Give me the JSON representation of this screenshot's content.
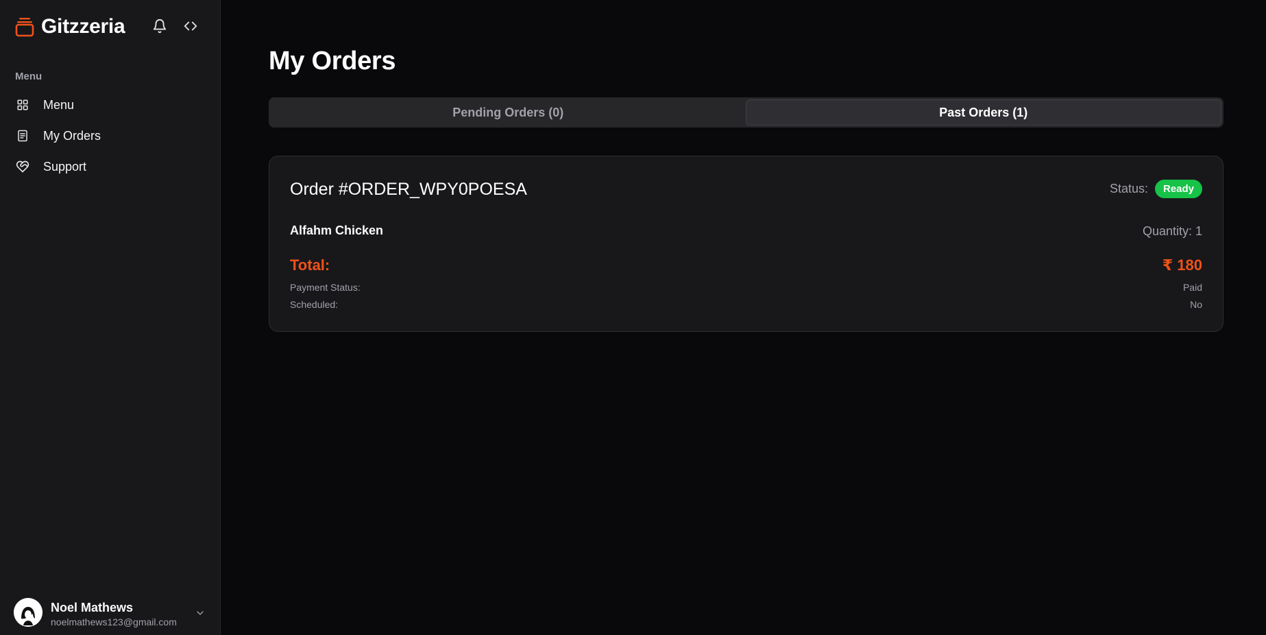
{
  "brand": {
    "name": "Gitzzeria",
    "accent": "#f0521a"
  },
  "sidebar": {
    "heading": "Menu",
    "items": [
      {
        "label": "Menu",
        "icon": "grid-icon"
      },
      {
        "label": "My Orders",
        "icon": "receipt-icon"
      },
      {
        "label": "Support",
        "icon": "heart-handshake-icon"
      }
    ],
    "user": {
      "name": "Noel Mathews",
      "email": "noelmathews123@gmail.com"
    }
  },
  "main": {
    "title": "My Orders",
    "tabs": [
      {
        "label": "Pending Orders (0)",
        "active": false
      },
      {
        "label": "Past Orders (1)",
        "active": true
      }
    ],
    "order": {
      "id": "Order #ORDER_WPY0POESA",
      "status_label": "Status:",
      "status": "Ready",
      "status_color": "#16c247",
      "item_name": "Alfahm Chicken",
      "quantity": "Quantity: 1",
      "total_label": "Total:",
      "total": "₹ 180",
      "payment_status_label": "Payment Status:",
      "payment_status": "Paid",
      "scheduled_label": "Scheduled:",
      "scheduled": "No"
    }
  }
}
